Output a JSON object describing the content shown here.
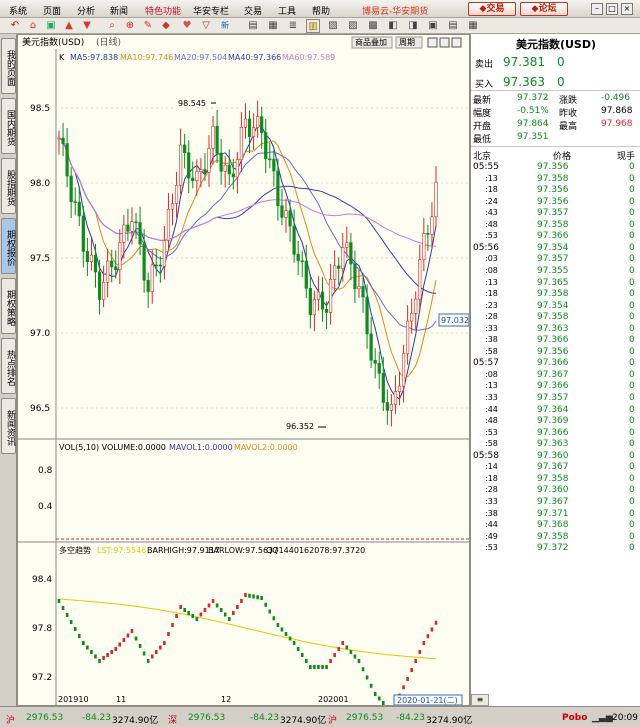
{
  "menu": {
    "items": [
      "系统",
      "页面",
      "分析",
      "新闻",
      "特色功能",
      "华安专栏",
      "交易",
      "工具",
      "帮助"
    ],
    "brand": "博易云-华安期货",
    "trade_btn": "交易",
    "forum_btn": "论坛"
  },
  "toolbar": {
    "new_label": "新"
  },
  "left_tabs": [
    "我的页面",
    "国内期货",
    "股指期货",
    "期权报价",
    "期权策略",
    "热点排名",
    "新闻资讯"
  ],
  "chart_header": {
    "title": "美元指数(USD)",
    "period": "(日线)",
    "btn1": "商品叠加",
    "btn2": "周期"
  },
  "ma_legend": {
    "k": "K",
    "ma5": "MA5:97.838",
    "ma10": "MA10:97.746",
    "ma20": "MA20:97.504",
    "ma40": "MA40:97.366",
    "ma60": "MA60:97.589"
  },
  "price_axis": {
    "labels": [
      "98.5",
      "98.0",
      "97.5",
      "97.0",
      "96.5"
    ]
  },
  "annotations": {
    "high": "98.545",
    "low": "96.352",
    "last": "97.032"
  },
  "vol": {
    "legend_vol": "VOL(5,10) VOLUME:0.0000",
    "legend_mavol1": "MAVOL1:0.0000",
    "legend_mavol2": "MAVOL2:0.0000",
    "axis": [
      "0.8",
      "0.4"
    ]
  },
  "indicator": {
    "title": "多空趋势",
    "lst": "LST:97.5546",
    "barhigh": "BARHIGH:97.9117",
    "barlow": "BARLOW:97.5637",
    "qq": "QQ1440162078:97.3720",
    "axis": [
      "98.4",
      "97.8",
      "97.2"
    ]
  },
  "x_axis": {
    "labels": [
      "201910",
      "11",
      "12",
      "202001"
    ],
    "date": "2020-01-21(二)"
  },
  "quote": {
    "title": "美元指数(USD)",
    "sell_label": "卖出",
    "sell_price": "97.381",
    "sell_vol": "0",
    "buy_label": "买入",
    "buy_price": "97.363",
    "buy_vol": "0",
    "rows": [
      [
        "最新",
        "97.372",
        "涨跌",
        "-0.496"
      ],
      [
        "幅度",
        "-0.51%",
        "昨收",
        "97.868"
      ],
      [
        "开盘",
        "97.864",
        "最高",
        "97.968"
      ],
      [
        "最低",
        "97.351",
        "",
        ""
      ]
    ],
    "col_headers": [
      "北京",
      "价格",
      "现手"
    ]
  },
  "ticks": [
    [
      "05:55",
      "97.356",
      "0"
    ],
    [
      ":13",
      "97.358",
      "0"
    ],
    [
      ":18",
      "97.356",
      "0"
    ],
    [
      ":24",
      "97.356",
      "0"
    ],
    [
      ":43",
      "97.357",
      "0"
    ],
    [
      ":48",
      "97.358",
      "0"
    ],
    [
      ":53",
      "97.366",
      "0"
    ],
    [
      "05:56",
      "97.354",
      "0"
    ],
    [
      ":03",
      "97.357",
      "0"
    ],
    [
      ":08",
      "97.355",
      "0"
    ],
    [
      ":13",
      "97.365",
      "0"
    ],
    [
      ":18",
      "97.358",
      "0"
    ],
    [
      ":23",
      "97.354",
      "0"
    ],
    [
      ":28",
      "97.358",
      "0"
    ],
    [
      ":33",
      "97.363",
      "0"
    ],
    [
      ":38",
      "97.366",
      "0"
    ],
    [
      ":58",
      "97.356",
      "0"
    ],
    [
      "05:57",
      "97.366",
      "0"
    ],
    [
      ":08",
      "97.367",
      "0"
    ],
    [
      ":13",
      "97.366",
      "0"
    ],
    [
      ":33",
      "97.357",
      "0"
    ],
    [
      ":44",
      "97.364",
      "0"
    ],
    [
      ":48",
      "97.369",
      "0"
    ],
    [
      ":53",
      "97.366",
      "0"
    ],
    [
      ":58",
      "97.363",
      "0"
    ],
    [
      "05:58",
      "97.360",
      "0"
    ],
    [
      ":14",
      "97.367",
      "0"
    ],
    [
      ":18",
      "97.358",
      "0"
    ],
    [
      ":28",
      "97.360",
      "0"
    ],
    [
      ":33",
      "97.367",
      "0"
    ],
    [
      ":38",
      "97.371",
      "0"
    ],
    [
      ":44",
      "97.368",
      "0"
    ],
    [
      ":49",
      "97.358",
      "0"
    ],
    [
      ":53",
      "97.372",
      "0"
    ]
  ],
  "status": {
    "a1": "沪",
    "a2": "2976.53",
    "a3": "-84.23",
    "a4": "3274.90亿",
    "b1": "深",
    "b2": "2976.53",
    "b3": "-84.23",
    "b4": "3274.90亿",
    "c1": "沪",
    "c2": "2976.53",
    "c3": "-84.23",
    "c4": "3274.90亿",
    "pobo": "Pobo",
    "time": "20:09"
  },
  "colors": {
    "up": "#d42a2a",
    "down": "#0e8a1e",
    "ma5": "#2a3a9c",
    "ma10": "#e08a1c",
    "ma20": "#6a6ad0",
    "ma40": "#3a3ab0",
    "ma60": "#d07ad0"
  }
}
